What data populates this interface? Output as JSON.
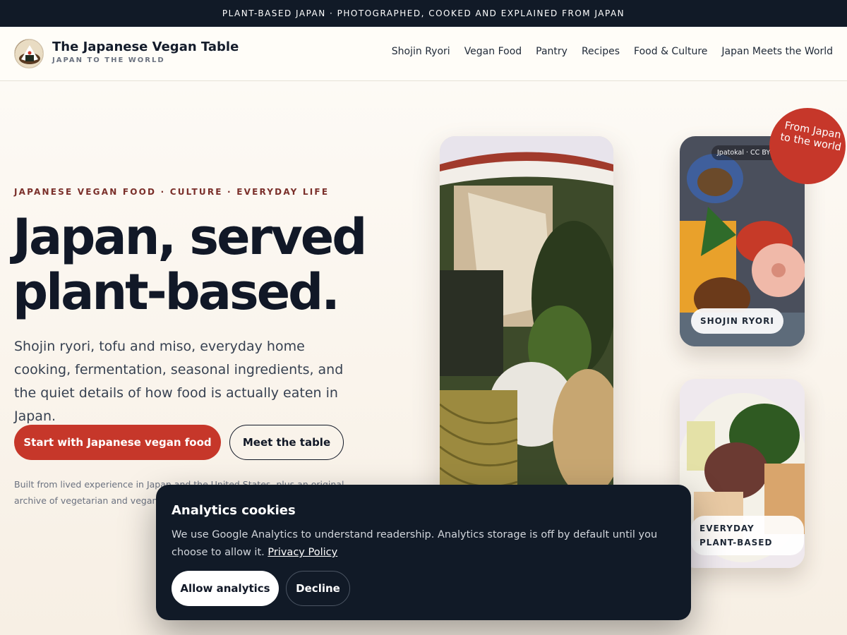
{
  "announcement": "PLANT-BASED JAPAN · PHOTOGRAPHED, COOKED AND EXPLAINED FROM JAPAN",
  "brand": {
    "logo_icon": "onigiri-logo",
    "title": "The Japanese Vegan Table",
    "subtitle": "JAPAN TO THE WORLD"
  },
  "nav": {
    "items": [
      {
        "label": "Shojin Ryori"
      },
      {
        "label": "Vegan Food"
      },
      {
        "label": "Pantry"
      },
      {
        "label": "Recipes"
      },
      {
        "label": "Food & Culture"
      },
      {
        "label": "Japan Meets the World"
      }
    ]
  },
  "hero": {
    "eyebrow": "JAPANESE VEGAN FOOD · CULTURE · EVERYDAY LIFE",
    "headline": "Japan, served plant-based.",
    "lead": "Shojin ryori, tofu and miso, everyday home cooking, fermentation, seasonal ingredients, and the quiet details of how food is actually eaten in Japan.",
    "primary_cta": "Start with Japanese vegan food",
    "secondary_cta": "Meet the table",
    "fineprint": "Built from lived experience in Japan and the United States, plus an original archive of vegetarian and vegan"
  },
  "gallery": {
    "credit": "Jpatokal · CC BY-SA 4.0",
    "stamp": "From Japan to the world",
    "card1_label": "SHOJIN RYORI",
    "card2_label": "EVERYDAY PLANT-BASED"
  },
  "cookie_banner": {
    "title": "Analytics cookies",
    "body": "We use Google Analytics to understand readership. Analytics storage is off by default until you choose to allow it.",
    "link": "Privacy Policy",
    "allow": "Allow analytics",
    "decline": "Decline"
  },
  "colors": {
    "accent": "#c6372a",
    "dark": "#111a27",
    "background": "#fbf6ef"
  }
}
